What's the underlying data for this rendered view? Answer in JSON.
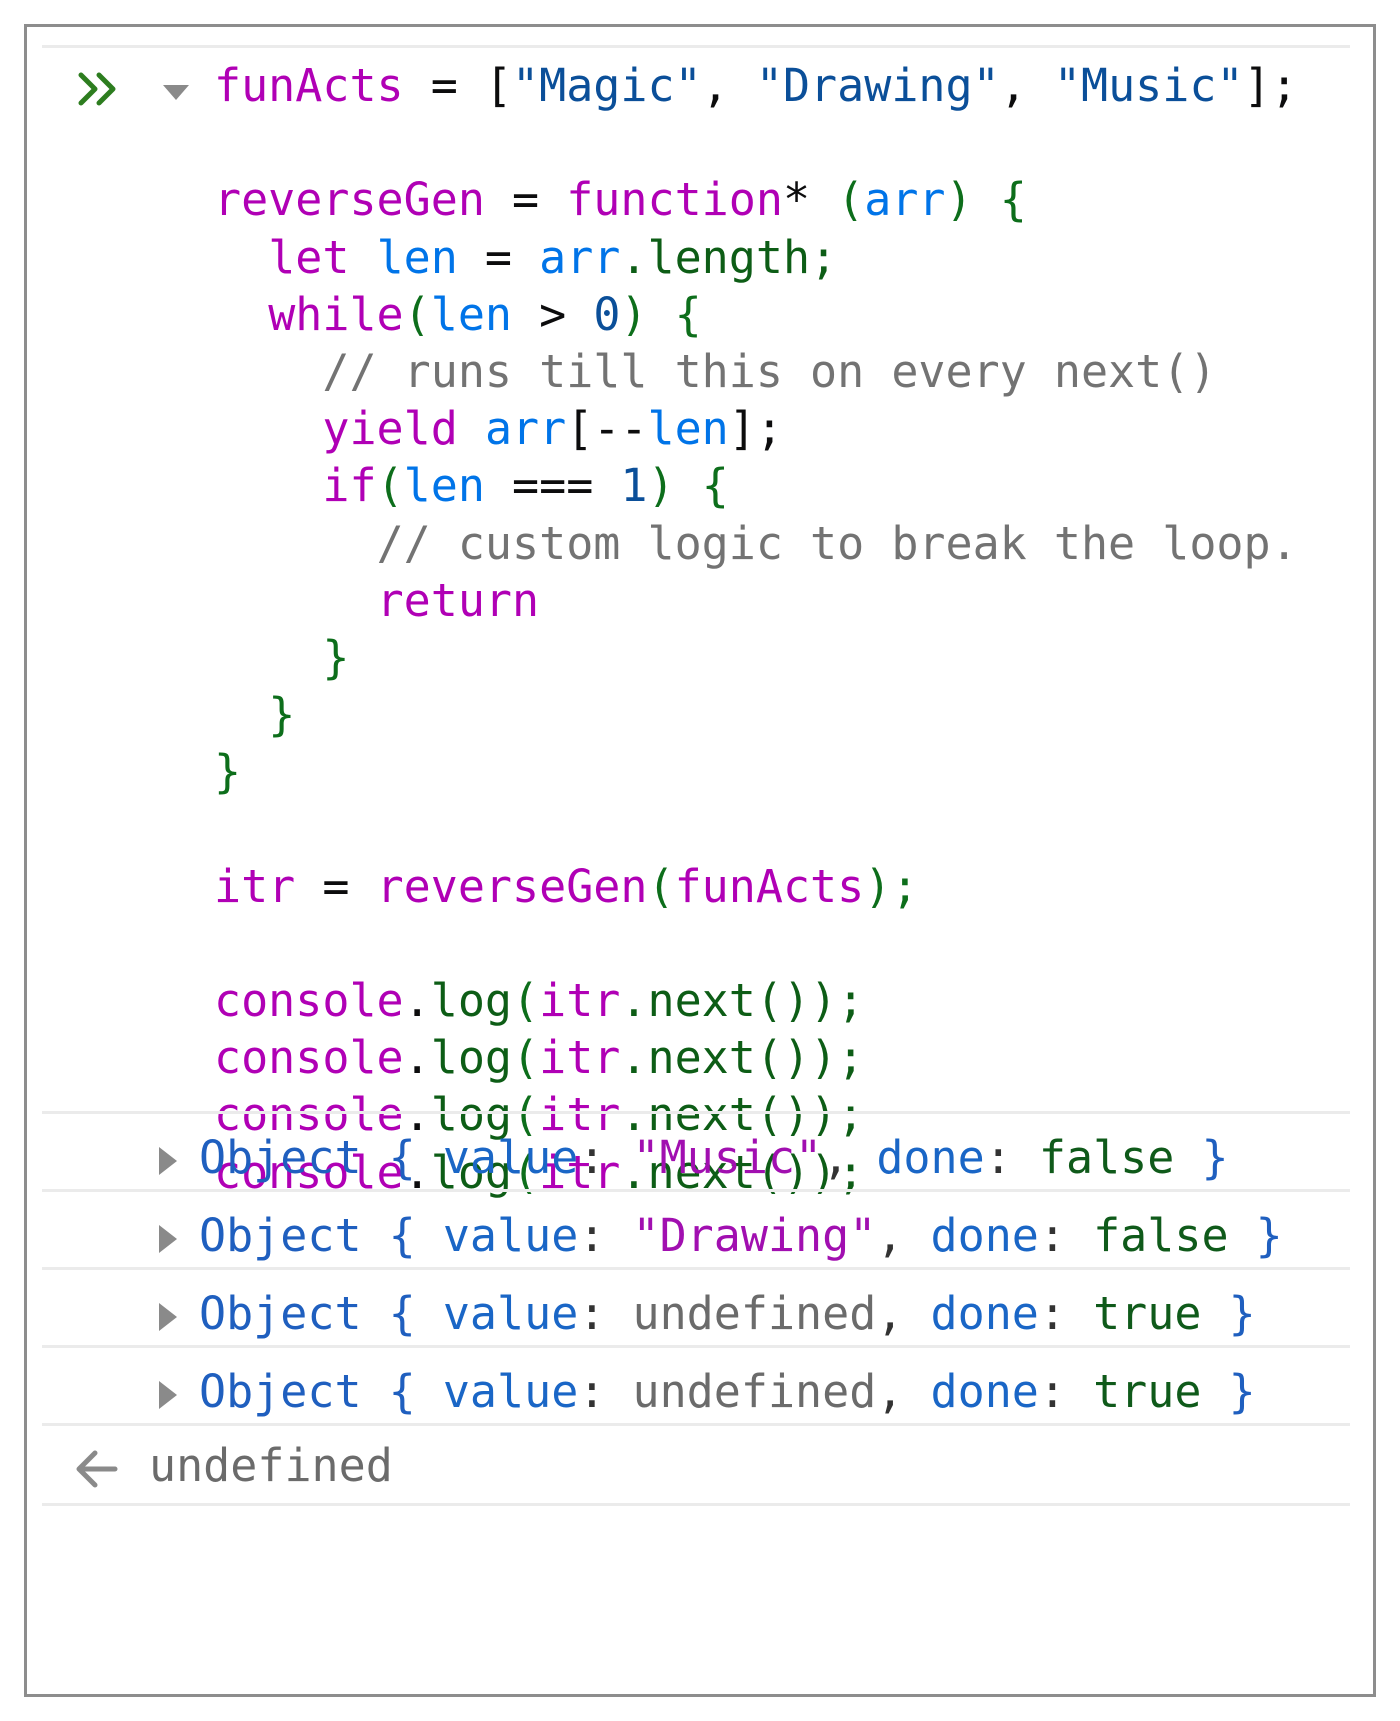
{
  "colors": {
    "frame_border": "#8d8d8d",
    "divider": "#ebebeb",
    "prompt_icon": "#2d7d1f",
    "variable": "#b000b5",
    "definition": "#0074e8",
    "string": "#0b4f99",
    "comment": "#737373",
    "bracket": "#0d6e1b"
  },
  "input": {
    "prompt_icon": "double-chevron-right-icon",
    "expand_icon": "caret-down-icon",
    "code_lines": [
      [
        {
          "t": "funActs",
          "c": "var"
        },
        {
          "t": " = ",
          "c": "pun"
        },
        {
          "t": "[",
          "c": "pun"
        },
        {
          "t": "\"Magic\"",
          "c": "str"
        },
        {
          "t": ", ",
          "c": "pun"
        },
        {
          "t": "\"Drawing\"",
          "c": "str"
        },
        {
          "t": ", ",
          "c": "pun"
        },
        {
          "t": "\"Music\"",
          "c": "str"
        },
        {
          "t": "];",
          "c": "pun"
        }
      ],
      [],
      [
        {
          "t": "reverseGen",
          "c": "var"
        },
        {
          "t": " = ",
          "c": "pun"
        },
        {
          "t": "function",
          "c": "kw"
        },
        {
          "t": "* ",
          "c": "pun"
        },
        {
          "t": "(",
          "c": "bra"
        },
        {
          "t": "arr",
          "c": "def"
        },
        {
          "t": ") ",
          "c": "bra"
        },
        {
          "t": "{",
          "c": "bra"
        }
      ],
      [
        {
          "t": "  ",
          "c": "pun"
        },
        {
          "t": "let",
          "c": "kw"
        },
        {
          "t": " ",
          "c": "pun"
        },
        {
          "t": "len",
          "c": "def"
        },
        {
          "t": " = ",
          "c": "pun"
        },
        {
          "t": "arr",
          "c": "def"
        },
        {
          "t": ".length;",
          "c": "prop"
        }
      ],
      [
        {
          "t": "  ",
          "c": "pun"
        },
        {
          "t": "while",
          "c": "kw"
        },
        {
          "t": "(",
          "c": "bra"
        },
        {
          "t": "len",
          "c": "def"
        },
        {
          "t": " > ",
          "c": "pun"
        },
        {
          "t": "0",
          "c": "num"
        },
        {
          "t": ") ",
          "c": "bra"
        },
        {
          "t": "{",
          "c": "bra"
        }
      ],
      [
        {
          "t": "    ",
          "c": "pun"
        },
        {
          "t": "// runs till this on every next()",
          "c": "com"
        }
      ],
      [
        {
          "t": "    ",
          "c": "pun"
        },
        {
          "t": "yield",
          "c": "kw"
        },
        {
          "t": " ",
          "c": "pun"
        },
        {
          "t": "arr",
          "c": "def"
        },
        {
          "t": "[--",
          "c": "pun"
        },
        {
          "t": "len",
          "c": "def"
        },
        {
          "t": "];",
          "c": "pun"
        }
      ],
      [
        {
          "t": "    ",
          "c": "pun"
        },
        {
          "t": "if",
          "c": "kw"
        },
        {
          "t": "(",
          "c": "bra"
        },
        {
          "t": "len",
          "c": "def"
        },
        {
          "t": " === ",
          "c": "pun"
        },
        {
          "t": "1",
          "c": "num"
        },
        {
          "t": ") ",
          "c": "bra"
        },
        {
          "t": "{",
          "c": "bra"
        }
      ],
      [
        {
          "t": "      ",
          "c": "pun"
        },
        {
          "t": "// custom logic to break the loop.",
          "c": "com"
        }
      ],
      [
        {
          "t": "      ",
          "c": "pun"
        },
        {
          "t": "return",
          "c": "kw"
        }
      ],
      [
        {
          "t": "    ",
          "c": "pun"
        },
        {
          "t": "}",
          "c": "bra"
        }
      ],
      [
        {
          "t": "  ",
          "c": "pun"
        },
        {
          "t": "}",
          "c": "bra"
        }
      ],
      [
        {
          "t": "}",
          "c": "bra"
        }
      ],
      [],
      [
        {
          "t": "itr",
          "c": "var"
        },
        {
          "t": " = ",
          "c": "pun"
        },
        {
          "t": "reverseGen",
          "c": "var"
        },
        {
          "t": "(",
          "c": "bra"
        },
        {
          "t": "funActs",
          "c": "var"
        },
        {
          "t": ");",
          "c": "bra"
        }
      ],
      [],
      [
        {
          "t": "console",
          "c": "var"
        },
        {
          "t": ".",
          "c": "pun"
        },
        {
          "t": "log",
          "c": "prop"
        },
        {
          "t": "(",
          "c": "bra"
        },
        {
          "t": "itr",
          "c": "var"
        },
        {
          "t": ".next());",
          "c": "prop"
        }
      ],
      [
        {
          "t": "console",
          "c": "var"
        },
        {
          "t": ".",
          "c": "pun"
        },
        {
          "t": "log",
          "c": "prop"
        },
        {
          "t": "(",
          "c": "bra"
        },
        {
          "t": "itr",
          "c": "var"
        },
        {
          "t": ".next());",
          "c": "prop"
        }
      ],
      [
        {
          "t": "console",
          "c": "var"
        },
        {
          "t": ".",
          "c": "pun"
        },
        {
          "t": "log",
          "c": "prop"
        },
        {
          "t": "(",
          "c": "bra"
        },
        {
          "t": "itr",
          "c": "var"
        },
        {
          "t": ".next());",
          "c": "prop"
        }
      ],
      [
        {
          "t": "console",
          "c": "var"
        },
        {
          "t": ".",
          "c": "pun"
        },
        {
          "t": "log",
          "c": "prop"
        },
        {
          "t": "(",
          "c": "bra"
        },
        {
          "t": "itr",
          "c": "var"
        },
        {
          "t": ".next());",
          "c": "prop"
        }
      ]
    ]
  },
  "outputs": [
    {
      "expand_icon": "caret-right-icon",
      "label": "Object",
      "open_brace": "{",
      "value_key": "value",
      "value": "\"Music\"",
      "value_kind": "string",
      "done_key": "done",
      "done": "false",
      "close_brace": "}"
    },
    {
      "expand_icon": "caret-right-icon",
      "label": "Object",
      "open_brace": "{",
      "value_key": "value",
      "value": "\"Drawing\"",
      "value_kind": "string",
      "done_key": "done",
      "done": "false",
      "close_brace": "}"
    },
    {
      "expand_icon": "caret-right-icon",
      "label": "Object",
      "open_brace": "{",
      "value_key": "value",
      "value": "undefined",
      "value_kind": "undefined",
      "done_key": "done",
      "done": "true",
      "close_brace": "}"
    },
    {
      "expand_icon": "caret-right-icon",
      "label": "Object",
      "open_brace": "{",
      "value_key": "value",
      "value": "undefined",
      "value_kind": "undefined",
      "done_key": "done",
      "done": "true",
      "close_brace": "}"
    }
  ],
  "result": {
    "icon": "return-arrow-left-icon",
    "text": "undefined"
  }
}
